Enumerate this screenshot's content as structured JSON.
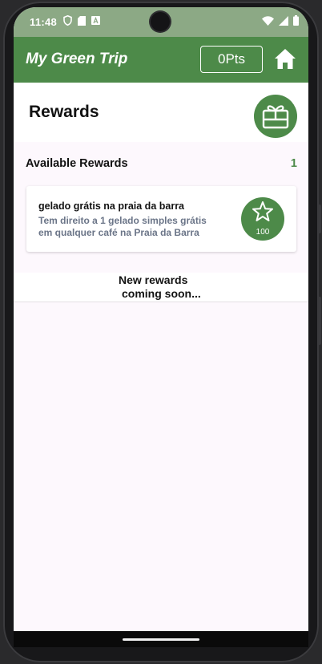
{
  "status_bar": {
    "time": "11:48",
    "left_icons": [
      "shield-icon",
      "sd-card-icon",
      "a-box-icon"
    ],
    "right_icons": [
      "wifi-icon",
      "signal-icon",
      "battery-icon"
    ]
  },
  "header": {
    "title": "My Green Trip",
    "points": "0Pts",
    "home_icon": "home-icon"
  },
  "page": {
    "title": "Rewards",
    "gift_icon": "gift-card-icon"
  },
  "available": {
    "label": "Available Rewards",
    "count": "1"
  },
  "rewards": [
    {
      "name": "gelado grátis na praia da barra",
      "description": "Tem direito a 1 gelado simples grátis em qualquer café na Praia da Barra",
      "cost": "100",
      "icon": "star-icon"
    }
  ],
  "coming_soon": {
    "line1": "New rewards",
    "line2": "coming soon..."
  },
  "colors": {
    "primary": "#4d8a49",
    "status_bar": "#8ca985",
    "desc_text": "#6b7588"
  }
}
